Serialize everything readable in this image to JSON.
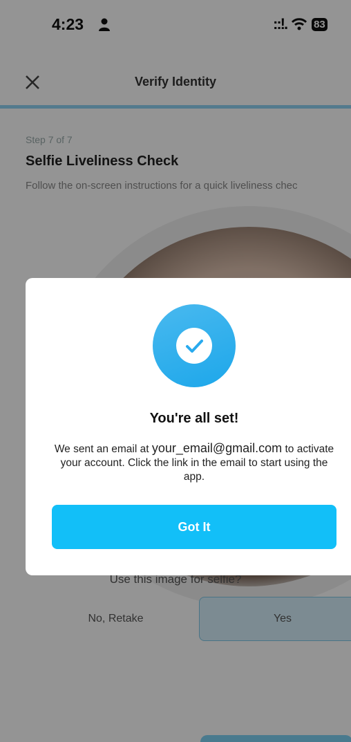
{
  "status_bar": {
    "time": "4:23",
    "signal": "::!.",
    "battery": "83"
  },
  "nav": {
    "title": "Verify Identity"
  },
  "page": {
    "step": "Step 7 of 7",
    "heading": "Selfie Liveliness Check",
    "subtitle": "Follow the on-screen instructions for a quick liveliness chec",
    "question": "Use this image for selfie?",
    "retake_label": "No, Retake",
    "yes_label": "Yes"
  },
  "modal": {
    "title": "You're all set!",
    "msg_before": "We sent an email at ",
    "email": "your_email@gmail.com",
    "msg_after": " to activate your account. Click the link in the email to start using the app.",
    "button_label": "Got It"
  },
  "colors": {
    "accent": "#12bff8",
    "check_gradient_start": "#49b9ef",
    "check_gradient_end": "#1da7ea"
  }
}
